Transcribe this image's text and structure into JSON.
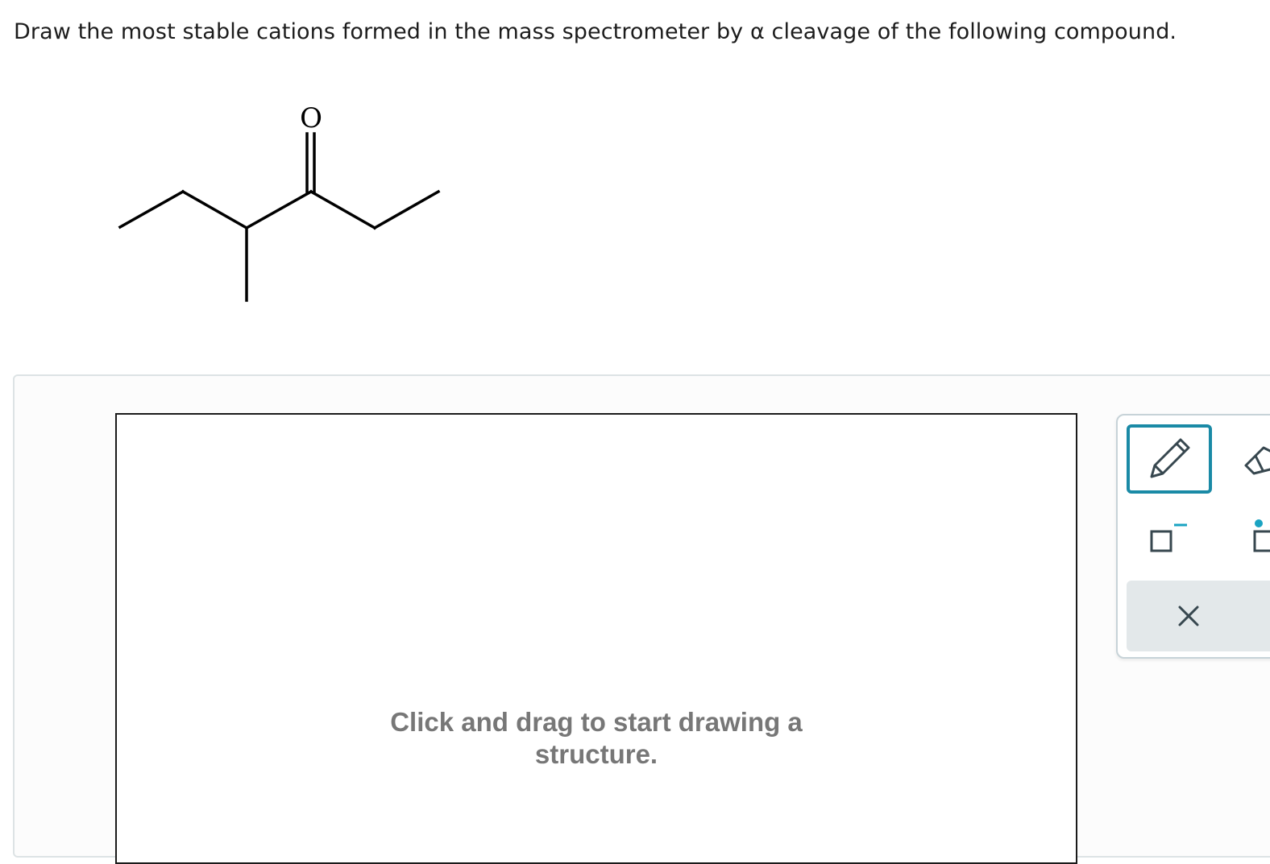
{
  "question": {
    "text": "Draw the most stable cations formed in the mass spectrometer by α cleavage of the following compound."
  },
  "molecule": {
    "oxygen_label": "O"
  },
  "canvas": {
    "hint_line1": "Click and drag to start drawing a",
    "hint_line2": "structure."
  },
  "toolbar": {
    "tools": [
      "pencil-icon",
      "eraser-icon",
      "negative-charge-icon",
      "radical-icon",
      "close-icon"
    ],
    "active_tool": "pencil-icon",
    "accent_color": "#1a8aa6",
    "charge_color": "#1aa3c2"
  },
  "colors": {
    "hint_text": "#777777",
    "panel_background": "#fcfcfc",
    "panel_border": "#dde3e5",
    "clear_button_background": "#e3e8ea"
  }
}
